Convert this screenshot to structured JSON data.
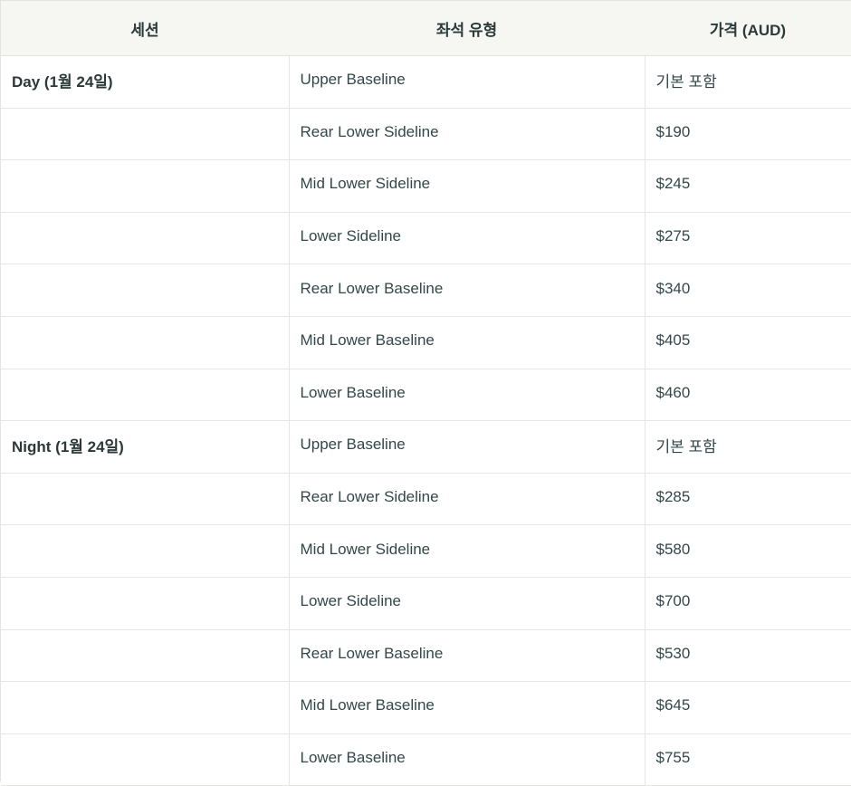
{
  "table": {
    "headers": [
      "세션",
      "좌석 유형",
      "가격 (AUD)"
    ],
    "rows": [
      {
        "session": "Day (1월 24일)",
        "seat": "Upper Baseline",
        "price": "기본 포함"
      },
      {
        "session": "",
        "seat": "Rear Lower Sideline",
        "price": "$190"
      },
      {
        "session": "",
        "seat": "Mid Lower Sideline",
        "price": "$245"
      },
      {
        "session": "",
        "seat": "Lower Sideline",
        "price": "$275"
      },
      {
        "session": "",
        "seat": "Rear Lower Baseline",
        "price": "$340"
      },
      {
        "session": "",
        "seat": "Mid Lower Baseline",
        "price": "$405"
      },
      {
        "session": "",
        "seat": "Lower Baseline",
        "price": "$460"
      },
      {
        "session": "Night (1월 24일)",
        "seat": "Upper Baseline",
        "price": "기본 포함"
      },
      {
        "session": "",
        "seat": "Rear Lower Sideline",
        "price": "$285"
      },
      {
        "session": "",
        "seat": "Mid Lower Sideline",
        "price": "$580"
      },
      {
        "session": "",
        "seat": "Lower Sideline",
        "price": "$700"
      },
      {
        "session": "",
        "seat": "Rear Lower Baseline",
        "price": "$530"
      },
      {
        "session": "",
        "seat": "Mid Lower Baseline",
        "price": "$645"
      },
      {
        "session": "",
        "seat": "Lower Baseline",
        "price": "$755"
      }
    ]
  }
}
